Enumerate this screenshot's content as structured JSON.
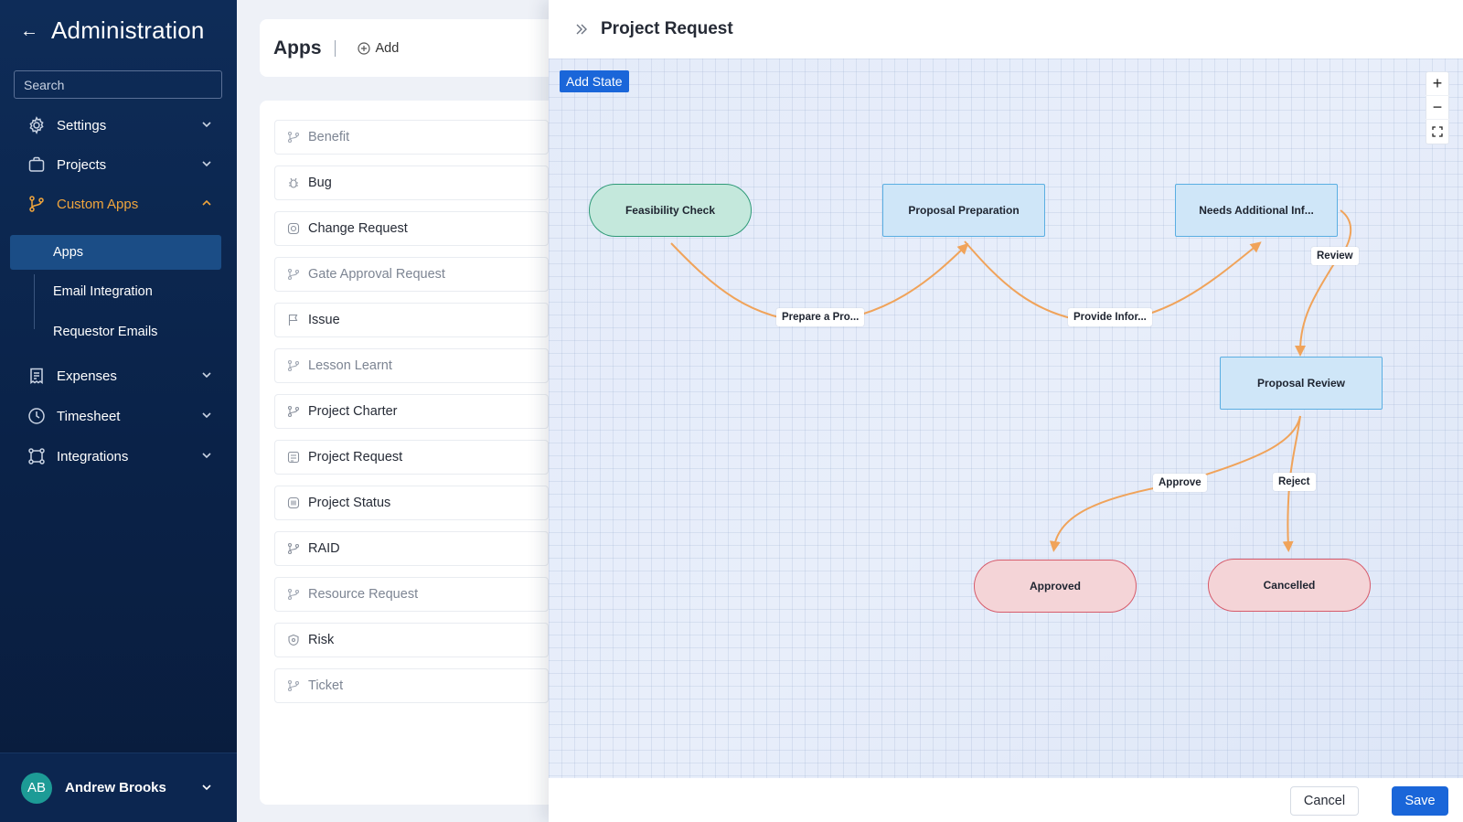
{
  "sidebar": {
    "title": "Administration",
    "search_placeholder": "Search",
    "nav": [
      {
        "label": "Settings",
        "icon": "gear-icon"
      },
      {
        "label": "Projects",
        "icon": "briefcase-icon"
      },
      {
        "label": "Custom Apps",
        "icon": "branch-icon",
        "expanded": true
      },
      {
        "label": "Expenses",
        "icon": "receipt-icon"
      },
      {
        "label": "Timesheet",
        "icon": "clock-icon"
      },
      {
        "label": "Integrations",
        "icon": "integrations-icon"
      }
    ],
    "sub_items": [
      "Apps",
      "Email Integration",
      "Requestor Emails"
    ],
    "active_sub": "Apps",
    "user": {
      "initials": "AB",
      "name": "Andrew Brooks"
    }
  },
  "apps": {
    "title": "Apps",
    "add_label": "Add",
    "items": [
      {
        "label": "Benefit",
        "icon": "branch-icon",
        "muted": true
      },
      {
        "label": "Bug",
        "icon": "bug-icon",
        "muted": false
      },
      {
        "label": "Change Request",
        "icon": "request-icon",
        "muted": false
      },
      {
        "label": "Gate Approval Request",
        "icon": "branch-icon",
        "muted": true
      },
      {
        "label": "Issue",
        "icon": "flag-icon",
        "muted": false
      },
      {
        "label": "Lesson Learnt",
        "icon": "branch-icon",
        "muted": true
      },
      {
        "label": "Project Charter",
        "icon": "branch-icon",
        "muted": false
      },
      {
        "label": "Project Request",
        "icon": "document-icon",
        "muted": false
      },
      {
        "label": "Project Status",
        "icon": "status-icon",
        "muted": false
      },
      {
        "label": "RAID",
        "icon": "branch-icon",
        "muted": false
      },
      {
        "label": "Resource Request",
        "icon": "branch-icon",
        "muted": true
      },
      {
        "label": "Risk",
        "icon": "shield-icon",
        "muted": false
      },
      {
        "label": "Ticket",
        "icon": "branch-icon",
        "muted": true
      }
    ]
  },
  "drawer": {
    "title": "Project Request",
    "add_state_label": "Add State",
    "zoom_in": "+",
    "zoom_out": "−",
    "cancel_label": "Cancel",
    "save_label": "Save"
  },
  "workflow": {
    "states": [
      {
        "id": "feasibility",
        "label": "Feasibility Check",
        "kind": "start"
      },
      {
        "id": "preparation",
        "label": "Proposal Preparation",
        "kind": "intermediate"
      },
      {
        "id": "needs_info",
        "label": "Needs Additional Inf...",
        "kind": "intermediate"
      },
      {
        "id": "review",
        "label": "Proposal Review",
        "kind": "intermediate"
      },
      {
        "id": "approved",
        "label": "Approved",
        "kind": "end"
      },
      {
        "id": "cancelled",
        "label": "Cancelled",
        "kind": "end"
      }
    ],
    "transitions": [
      {
        "label": "Prepare a Pro...",
        "from": "feasibility",
        "to": "preparation"
      },
      {
        "label": "Provide Infor...",
        "from": "preparation",
        "to": "needs_info"
      },
      {
        "label": "Review",
        "from": "needs_info",
        "to": "review"
      },
      {
        "label": "Approve",
        "from": "review",
        "to": "approved"
      },
      {
        "label": "Reject",
        "from": "review",
        "to": "cancelled"
      }
    ],
    "edge_color": "#f0a35a"
  },
  "colors": {
    "sidebar_bg": "#0e2c58",
    "accent": "#f0a53c",
    "primary_button": "#1a66d9"
  }
}
